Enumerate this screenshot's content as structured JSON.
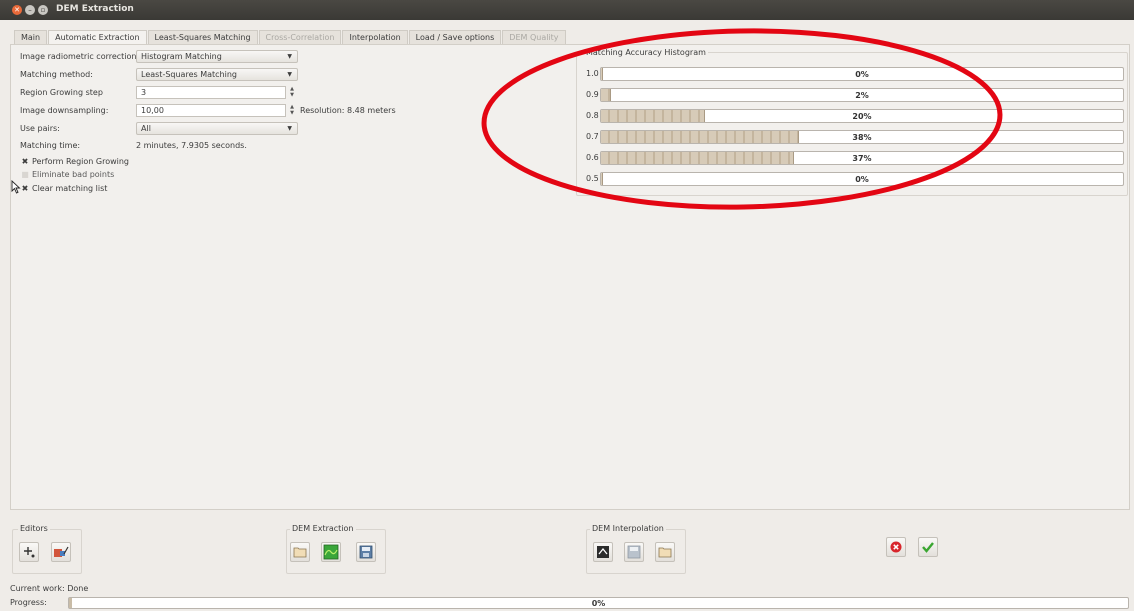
{
  "window": {
    "title": "DEM Extraction"
  },
  "tabs": [
    {
      "label": "Main",
      "state": "normal"
    },
    {
      "label": "Automatic Extraction",
      "state": "active"
    },
    {
      "label": "Least-Squares Matching",
      "state": "normal"
    },
    {
      "label": "Cross-Correlation",
      "state": "disabled"
    },
    {
      "label": "Interpolation",
      "state": "normal"
    },
    {
      "label": "Load / Save options",
      "state": "normal"
    },
    {
      "label": "DEM Quality",
      "state": "disabled"
    }
  ],
  "form": {
    "radiometric_label": "Image radiometric correction:",
    "radiometric_value": "Histogram Matching",
    "method_label": "Matching method:",
    "method_value": "Least-Squares Matching",
    "growing_step_label": "Region Growing step",
    "growing_step_value": "3",
    "downsampling_label": "Image downsampling:",
    "downsampling_value": "10,00",
    "resolution_text": "Resolution: 8.48 meters",
    "pairs_label": "Use pairs:",
    "pairs_value": "All",
    "time_label": "Matching time:",
    "time_value": "2 minutes, 7.9305 seconds.",
    "region_growing_label": "Perform Region Growing",
    "region_growing_checked": true,
    "eliminate_label": "Eliminate bad points",
    "eliminate_checked": false,
    "clear_list_label": "Clear matching list",
    "clear_list_checked": true
  },
  "histogram": {
    "title": "Matching Accuracy Histogram",
    "rows": [
      {
        "label": "1.0",
        "pct_text": "0%",
        "value": 0
      },
      {
        "label": "0.9",
        "pct_text": "2%",
        "value": 2
      },
      {
        "label": "0.8",
        "pct_text": "20%",
        "value": 20
      },
      {
        "label": "0.7",
        "pct_text": "38%",
        "value": 38
      },
      {
        "label": "0.6",
        "pct_text": "37%",
        "value": 37
      },
      {
        "label": "0.5",
        "pct_text": "0%",
        "value": 0
      }
    ]
  },
  "groups": {
    "editors": "Editors",
    "dem_extraction": "DEM Extraction",
    "dem_interpolation": "DEM Interpolation"
  },
  "status": {
    "current_work": "Current work: Done"
  },
  "progress": {
    "label": "Progress:",
    "pct_text": "0%",
    "value": 0
  },
  "colors": {
    "annotation": "#e30613",
    "ok_check": "#3aa631",
    "cancel": "#d8262c"
  }
}
